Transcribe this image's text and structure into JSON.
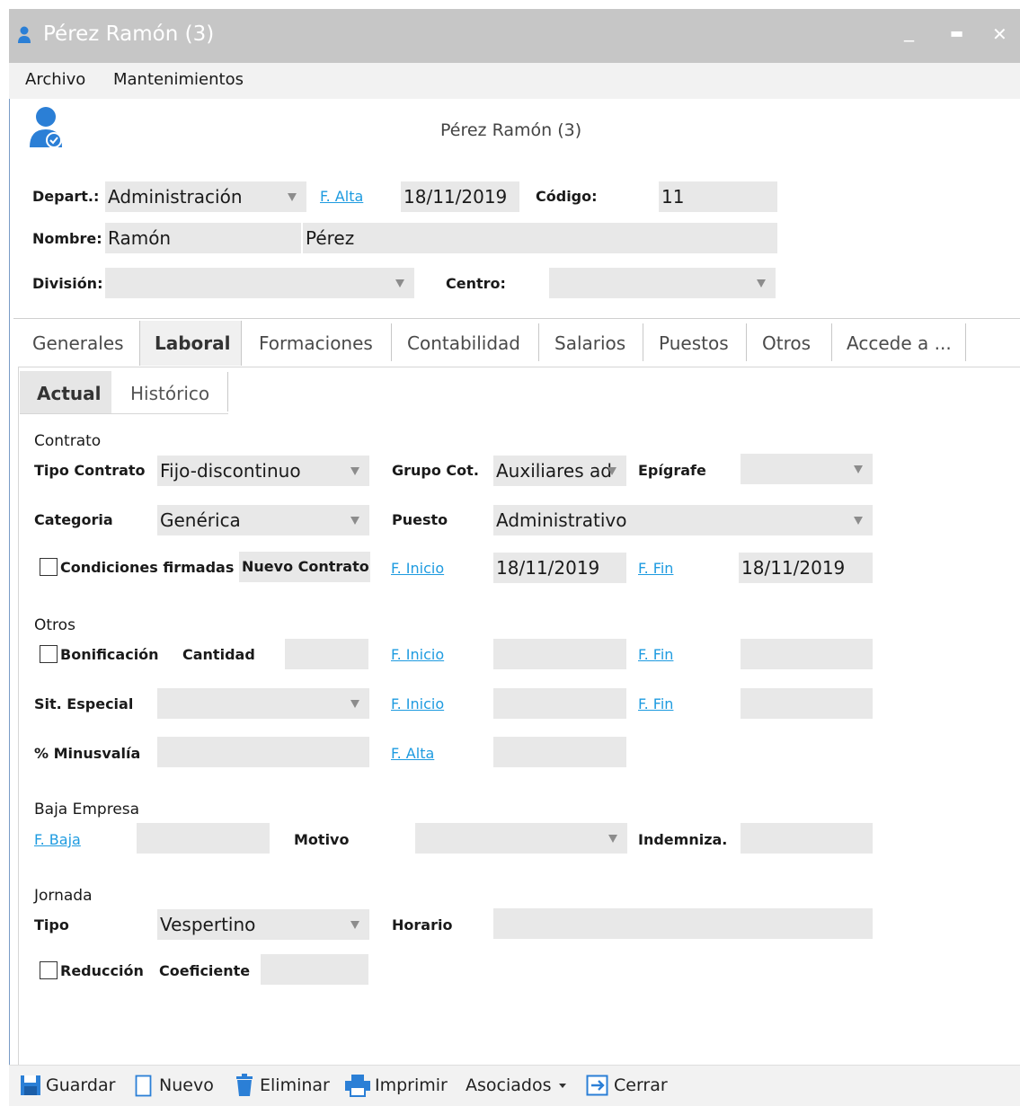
{
  "window": {
    "title": "Pérez Ramón (3)",
    "minimize": "_",
    "maximize": "▬",
    "close": "✕"
  },
  "menu": {
    "archivo": "Archivo",
    "mantenimientos": "Mantenimientos"
  },
  "header": {
    "name": "Pérez Ramón (3)"
  },
  "colors": {
    "link": "#1e9be0",
    "field_bg": "#e8e8e8",
    "icon_blue": "#2b7fd6",
    "titlebar_bg": "#c6c6c6"
  },
  "top": {
    "depart_label": "Depart.:",
    "depart_value": "Administración",
    "falta_label": "F. Alta",
    "falta_value": "18/11/2019",
    "codigo_label": "Código:",
    "codigo_value": "11",
    "nombre_label": "Nombre:",
    "nombre_value": "Ramón",
    "apellido_value": "Pérez",
    "division_label": "División:",
    "division_value": "",
    "centro_label": "Centro:",
    "centro_value": ""
  },
  "tabs": [
    {
      "label": "Generales",
      "active": false
    },
    {
      "label": "Laboral",
      "active": true
    },
    {
      "label": "Formaciones",
      "active": false
    },
    {
      "label": "Contabilidad",
      "active": false
    },
    {
      "label": "Salarios",
      "active": false
    },
    {
      "label": "Puestos",
      "active": false
    },
    {
      "label": "Otros",
      "active": false
    },
    {
      "label": "Accede a ...",
      "active": false
    }
  ],
  "subtabs": [
    {
      "label": "Actual",
      "active": true
    },
    {
      "label": "Histórico",
      "active": false
    }
  ],
  "contrato": {
    "section": "Contrato",
    "tipo_label": "Tipo Contrato",
    "tipo_value": "Fijo-discontinuo",
    "grupo_label": "Grupo Cot.",
    "grupo_value": "Auxiliares ad",
    "epigrafe_label": "Epígrafe",
    "epigrafe_value": "",
    "categoria_label": "Categoria",
    "categoria_value": "Genérica",
    "puesto_label": "Puesto",
    "puesto_value": "Administrativo",
    "condiciones_label": "Condiciones firmadas",
    "nuevo_btn": "Nuevo Contrato",
    "finicio_label": "F. Inicio",
    "finicio_value": "18/11/2019",
    "ffin_label": "F. Fin",
    "ffin_value": "18/11/2019"
  },
  "otros": {
    "section": "Otros",
    "bonificacion_label": "Bonificación",
    "cantidad_label": "Cantidad",
    "finicio_label": "F. Inicio",
    "ffin_label": "F. Fin",
    "sit_label": "Sit. Especial",
    "minus_label": "% Minusvalía",
    "falta_label": "F. Alta"
  },
  "baja": {
    "section": "Baja Empresa",
    "fbaja_label": "F. Baja",
    "motivo_label": "Motivo",
    "indem_label": "Indemniza."
  },
  "jornada": {
    "section": "Jornada",
    "tipo_label": "Tipo",
    "tipo_value": "Vespertino",
    "horario_label": "Horario",
    "reduccion_label": "Reducción",
    "coef_label": "Coeficiente"
  },
  "toolbar": {
    "guardar": "Guardar",
    "nuevo": "Nuevo",
    "eliminar": "Eliminar",
    "imprimir": "Imprimir",
    "asociados": "Asociados",
    "cerrar": "Cerrar"
  }
}
